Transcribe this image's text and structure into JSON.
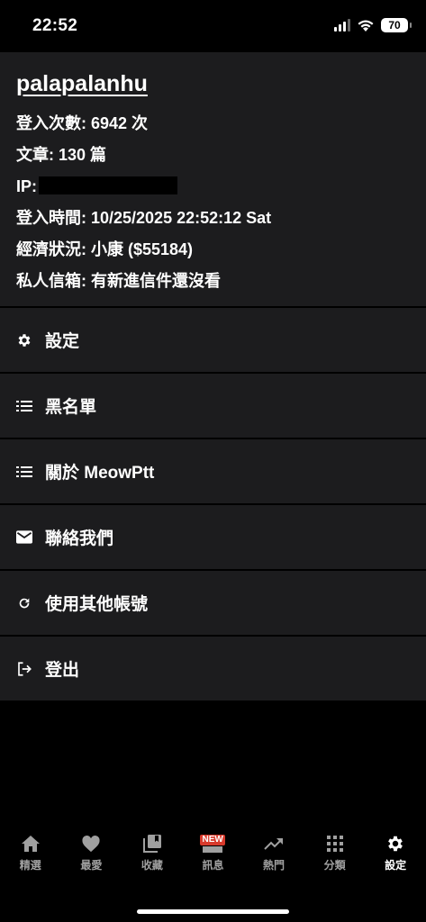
{
  "status_bar": {
    "time": "22:52",
    "battery": "70"
  },
  "profile": {
    "username": "palapalanhu",
    "login_count": "登入次數: 6942 次",
    "articles": "文章: 130 篇",
    "ip_label": "IP:",
    "login_time": "登入時間: 10/25/2025 22:52:12 Sat",
    "economy": "經濟狀況: 小康 ($55184)",
    "mailbox": "私人信箱: 有新進信件還沒看"
  },
  "menu": {
    "items": [
      {
        "label": "設定",
        "icon": "gear-icon"
      },
      {
        "label": "黑名單",
        "icon": "list-icon"
      },
      {
        "label": "關於 MeowPtt",
        "icon": "list-icon"
      },
      {
        "label": "聯絡我們",
        "icon": "mail-icon"
      },
      {
        "label": "使用其他帳號",
        "icon": "refresh-icon"
      },
      {
        "label": "登出",
        "icon": "logout-icon"
      }
    ]
  },
  "tabbar": {
    "tabs": [
      {
        "label": "精選",
        "icon": "home-icon"
      },
      {
        "label": "最愛",
        "icon": "heart-icon"
      },
      {
        "label": "收藏",
        "icon": "library-icon"
      },
      {
        "label": "訊息",
        "icon": "new-icon",
        "badge": "NEW"
      },
      {
        "label": "熱門",
        "icon": "trending-icon"
      },
      {
        "label": "分類",
        "icon": "grid-icon"
      },
      {
        "label": "設定",
        "icon": "gear-icon",
        "active": true
      }
    ]
  },
  "colors": {
    "background": "#000000",
    "card": "#1c1c1e",
    "text": "#ffffff",
    "inactive_tab": "#a0a0a0",
    "badge": "#d83a2c"
  }
}
